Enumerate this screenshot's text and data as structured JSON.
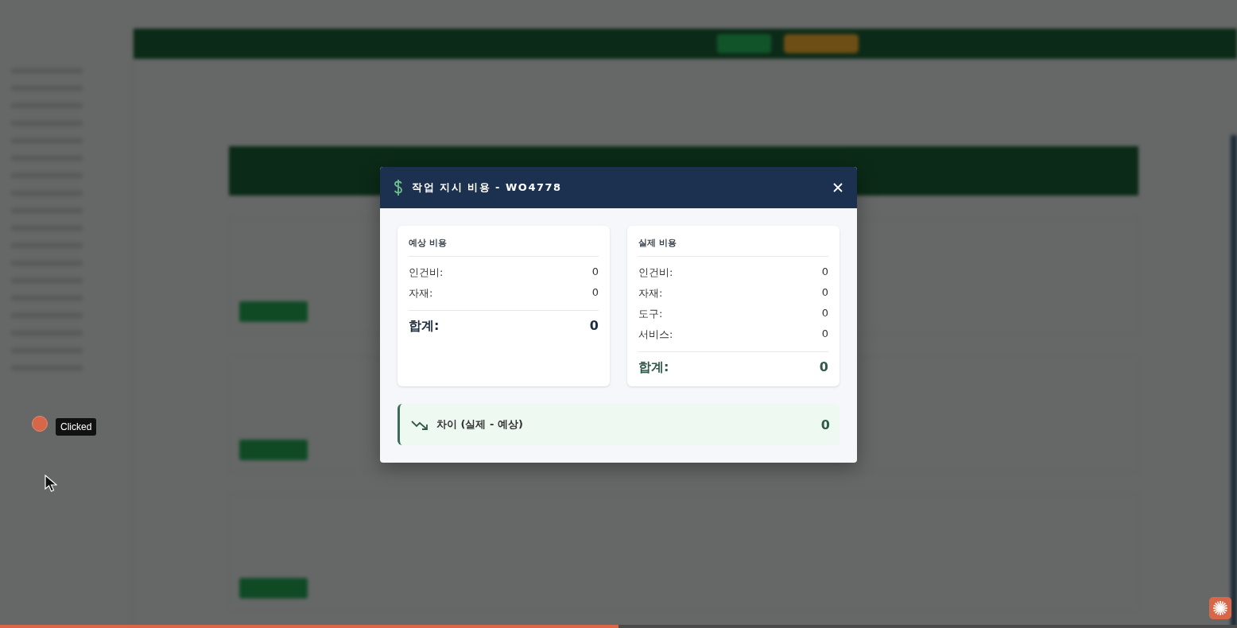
{
  "modal": {
    "title": "작업 지시 비용 - WO4778",
    "cards": [
      {
        "kind": "estimated",
        "title": "예상 비용",
        "rows": [
          {
            "label": "인건비:",
            "value": "0"
          },
          {
            "label": "자재:",
            "value": "0"
          }
        ],
        "total": {
          "label": "합계:",
          "value": "0"
        }
      },
      {
        "kind": "actual",
        "title": "실제 비용",
        "rows": [
          {
            "label": "인건비:",
            "value": "0"
          },
          {
            "label": "자재:",
            "value": "0"
          },
          {
            "label": "도구:",
            "value": "0"
          },
          {
            "label": "서비스:",
            "value": "0"
          }
        ],
        "total": {
          "label": "합계:",
          "value": "0"
        }
      }
    ],
    "variance": {
      "label": "차이 (실제 - 예상)",
      "value": "0"
    }
  },
  "recording": {
    "tooltip": "Clicked",
    "progress": {
      "level": 0.5
    }
  }
}
